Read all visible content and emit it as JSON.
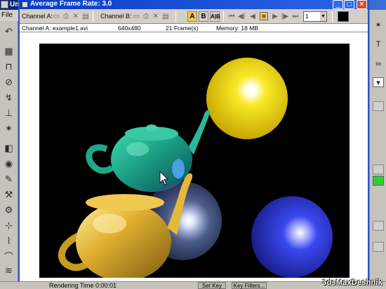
{
  "background_app": {
    "title": "Un",
    "menu_file": "File",
    "status_render_time": "Rendering Time  0:00:01",
    "set_key_label": "Set Key",
    "key_filters_label": "Key Filters..."
  },
  "frame_buffer": {
    "title": "Average Frame Rate: 3.0",
    "controls": {
      "minimize": "_",
      "maximize": "□",
      "close": "✕"
    },
    "toolbar": {
      "channel_a_label": "Channel A:",
      "channel_b_label": "Channel B:",
      "chan_a": "A",
      "chan_b": "B",
      "chan_ab": "A|B",
      "frame_select": "1"
    },
    "info": {
      "channel": "Channel A: example1.avi",
      "resolution": "640x480",
      "frames": "21 Frame(s)",
      "memory": "Memory: 18 MB"
    }
  },
  "watermark": "3dsMaxDeshnik",
  "colors": {
    "title_blue": "#0b3cc8",
    "render_bg": "#000000",
    "teapot_teal": "#1fa88a",
    "teapot_gold": "#d9a520",
    "sphere_yellow": "#f4e21c",
    "sphere_blue": "#2f3ee0",
    "sphere_glass": "#8fa3c7"
  }
}
